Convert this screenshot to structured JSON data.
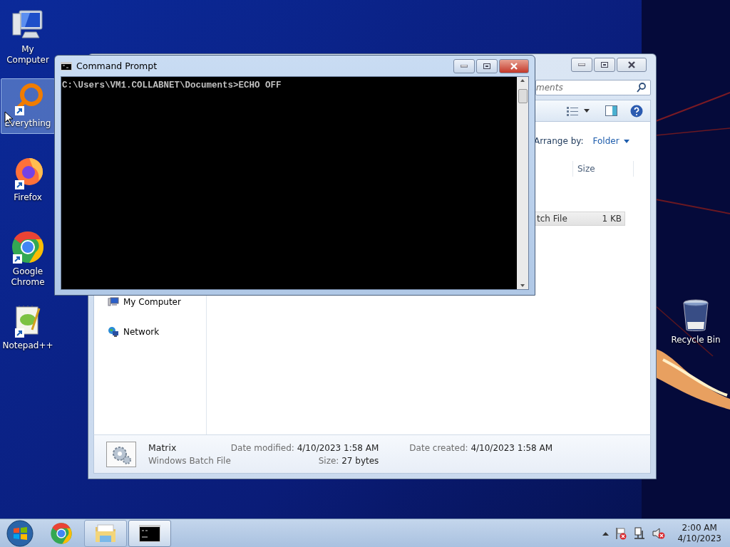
{
  "desktop_icons": [
    {
      "label": "My Computer",
      "kind": "computer",
      "shortcut": false,
      "selected": false
    },
    {
      "label": "Everything",
      "kind": "everything",
      "shortcut": true,
      "selected": true
    },
    {
      "label": "Firefox",
      "kind": "firefox",
      "shortcut": true,
      "selected": false
    },
    {
      "label": "Google Chrome",
      "kind": "chrome",
      "shortcut": true,
      "selected": false
    },
    {
      "label": "Notepad++",
      "kind": "notepad",
      "shortcut": true,
      "selected": false
    }
  ],
  "recycle_bin": {
    "label": "Recycle Bin"
  },
  "explorer": {
    "search": {
      "placeholder": "ments"
    },
    "arrange_by": {
      "label": "Arrange by:",
      "value": "Folder"
    },
    "columns": [
      "Size"
    ],
    "rows": [
      {
        "type": "tch File",
        "size": "1 KB",
        "selected": true
      }
    ],
    "nav": [
      {
        "label": "My Computer",
        "kind": "computer"
      },
      {
        "label": "Network",
        "kind": "network"
      }
    ],
    "details": {
      "name": "Matrix",
      "type": "Windows Batch File",
      "fields": [
        {
          "label": "Date modified:",
          "value": "4/10/2023 1:58 AM"
        },
        {
          "label": "Size:",
          "value": "27 bytes"
        },
        {
          "label": "Date created:",
          "value": "4/10/2023 1:58 AM"
        }
      ]
    }
  },
  "cmd": {
    "title": "Command Prompt",
    "lines": [
      "C:\\Users\\VM1.COLLABNET\\Documents>ECHO OFF"
    ]
  },
  "taskbar": {
    "items": [
      {
        "kind": "chrome",
        "open": false,
        "active": false
      },
      {
        "kind": "explorer",
        "open": true,
        "active": false
      },
      {
        "kind": "cmd",
        "open": true,
        "active": true
      }
    ],
    "clock": {
      "time": "2:00 AM",
      "date": "4/10/2023"
    }
  }
}
